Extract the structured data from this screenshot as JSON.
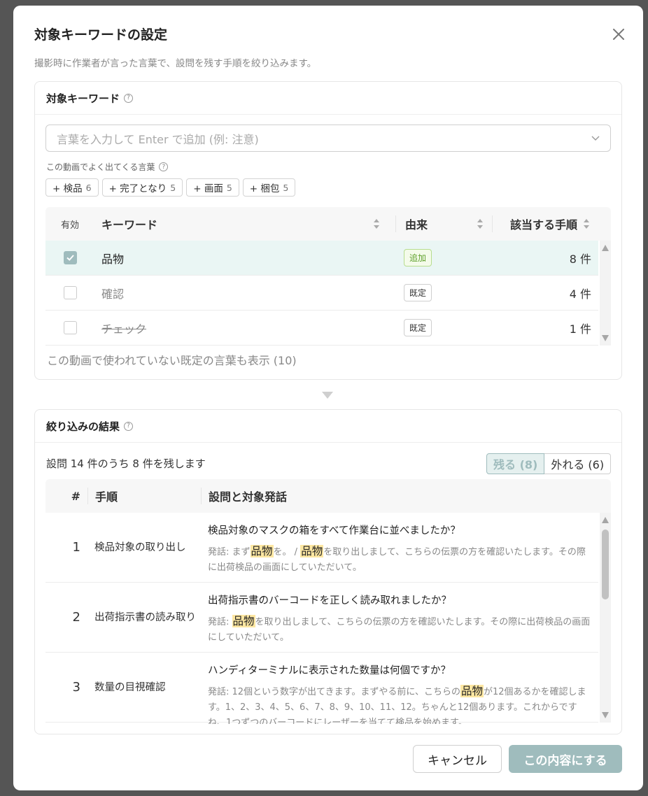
{
  "modal": {
    "title": "対象キーワードの設定",
    "subtitle": "撮影時に作業者が言った言葉で、設問を残す手順を絞り込みます。"
  },
  "keywords_section": {
    "heading": "対象キーワード",
    "input_placeholder": "言葉を入力して Enter で追加 (例: 注意)",
    "frequent_label": "この動画でよく出てくる言葉",
    "chips": [
      {
        "label": "+ 検品",
        "count": "6"
      },
      {
        "label": "+ 完了となり",
        "count": "5"
      },
      {
        "label": "+ 画面",
        "count": "5"
      },
      {
        "label": "+ 梱包",
        "count": "5"
      }
    ],
    "table": {
      "headers": {
        "enabled": "有効",
        "keyword": "キーワード",
        "source": "由来",
        "steps": "該当する手順"
      },
      "rows": [
        {
          "checked": true,
          "keyword": "品物",
          "source": "追加",
          "steps": "8 件"
        },
        {
          "checked": false,
          "keyword": "確認",
          "source": "既定",
          "steps": "4 件"
        },
        {
          "checked": false,
          "keyword": "チェック",
          "source": "既定",
          "steps": "1 件"
        }
      ]
    },
    "show_unused": "この動画で使われていない既定の言葉も表示 (10)"
  },
  "results_section": {
    "heading": "絞り込みの結果",
    "summary": "設問 14 件のうち 8 件を残します",
    "segments": {
      "keep": "残る (8)",
      "remove": "外れる (6)"
    },
    "table": {
      "headers": {
        "num": "#",
        "step": "手順",
        "question": "設問と対象発話"
      },
      "rows": [
        {
          "num": "1",
          "step": "検品対象の取り出し",
          "question": "検品対象のマスクの箱をすべて作業台に並べましたか？",
          "utt_prefix": "発話: まず",
          "hl1": "品物",
          "utt_mid": "を。 / ",
          "hl2": "品物",
          "utt_suffix": "を取り出しまして、こちらの伝票の方を確認いたします。その際に出荷検品の画面にしていただいて。"
        },
        {
          "num": "2",
          "step": "出荷指示書の読み取り",
          "question": "出荷指示書のバーコードを正しく読み取れましたか？",
          "utt_prefix": "発話: ",
          "hl1": "品物",
          "utt_suffix": "を取り出しまして、こちらの伝票の方を確認いたします。その際に出荷検品の画面にしていただいて。"
        },
        {
          "num": "3",
          "step": "数量の目視確認",
          "question": "ハンディターミナルに表示された数量は何個ですか？",
          "utt_prefix": "発話: 12個という数字が出てきます。まずやる前に、こちらの",
          "hl1": "品物",
          "utt_suffix": "が12個あるかを確認します。1、2、3、4、5、6、7、8、9、10、11、12。ちゃんと12個あります。これからですね、1つずつのバーコードにレーザーを当てて検品を始めます。"
        }
      ]
    }
  },
  "footer": {
    "cancel": "キャンセル",
    "apply": "この内容にする"
  },
  "colors": {
    "accent": "#9fbcbd",
    "highlight": "#fde7a2",
    "added_tag": "#5ea02a",
    "overlay": "#555555"
  }
}
